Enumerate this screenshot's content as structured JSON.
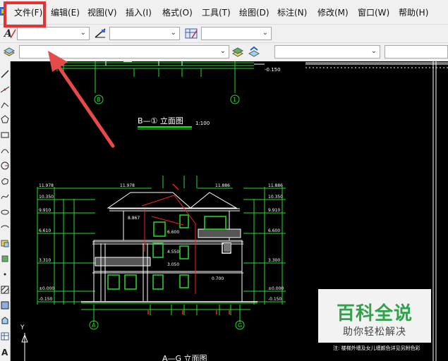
{
  "menu": {
    "items": [
      {
        "label": "文件(F)"
      },
      {
        "label": "编辑(E)"
      },
      {
        "label": "视图(V)"
      },
      {
        "label": "插入(I)"
      },
      {
        "label": "格式(O)"
      },
      {
        "label": "工具(T)"
      },
      {
        "label": "绘图(D)"
      },
      {
        "label": "标注(N)"
      },
      {
        "label": "修改(M)"
      },
      {
        "label": "窗口(W)"
      },
      {
        "label": "帮助(H)"
      }
    ]
  },
  "drawing": {
    "upper_title": "B—① 立面图",
    "upper_scale": "1:100",
    "lower_title": "A—G 立面图",
    "axis_upper_left": "B",
    "axis_upper_right": "1",
    "axis_lower_left": "A",
    "axis_lower_right": "G",
    "elev_left": [
      "11.978",
      "10.350",
      "9.910",
      "6.610",
      "3.310",
      "±0.000",
      "-0.150"
    ],
    "elev_right": [
      "11.886",
      "10.350",
      "9.910",
      "6.600",
      "3.300",
      "±0.000",
      "-0.150"
    ],
    "elev_top_left": "11.978",
    "elev_top_right": "11.886",
    "elev_mid": [
      "8.867",
      "6.600",
      "4.550",
      "3.050",
      "0.700"
    ],
    "upper_right_elev": "-0.150",
    "note": "注: 楼梯外墙及女儿墙颜色详见另附色彩",
    "ucs_y": "Y"
  },
  "watermark": {
    "title": "百科全说",
    "subtitle": "助你轻松解决"
  },
  "colors": {
    "highlight": "#e53333",
    "arrow": "#e84a4a",
    "cad_green": "#22e022",
    "cad_white": "#ffffff",
    "cad_red": "#ff2020",
    "watermark_green": "#2fa24a"
  }
}
